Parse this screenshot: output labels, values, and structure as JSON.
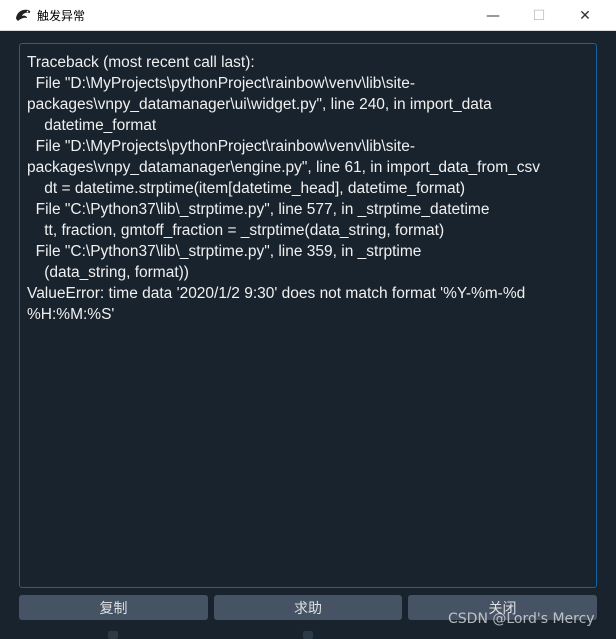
{
  "window": {
    "title": "触发异常",
    "icon": "snake-icon",
    "minimize_icon": "—",
    "maximize_icon": "☐",
    "close_icon": "✕"
  },
  "traceback_text": "Traceback (most recent call last):\n  File \"D:\\MyProjects\\pythonProject\\rainbow\\venv\\lib\\site-packages\\vnpy_datamanager\\ui\\widget.py\", line 240, in import_data\n    datetime_format\n  File \"D:\\MyProjects\\pythonProject\\rainbow\\venv\\lib\\site-packages\\vnpy_datamanager\\engine.py\", line 61, in import_data_from_csv\n    dt = datetime.strptime(item[datetime_head], datetime_format)\n  File \"C:\\Python37\\lib\\_strptime.py\", line 577, in _strptime_datetime\n    tt, fraction, gmtoff_fraction = _strptime(data_string, format)\n  File \"C:\\Python37\\lib\\_strptime.py\", line 359, in _strptime\n    (data_string, format))\nValueError: time data '2020/1/2 9:30' does not match format '%Y-%m-%d %H:%M:%S'",
  "buttons": {
    "copy": "复制",
    "help": "求助",
    "close": "关闭"
  },
  "watermark": "CSDN @Lord's Mercy",
  "colors": {
    "background": "#19232d",
    "border_accent": "#1464a0",
    "button": "#455364"
  }
}
